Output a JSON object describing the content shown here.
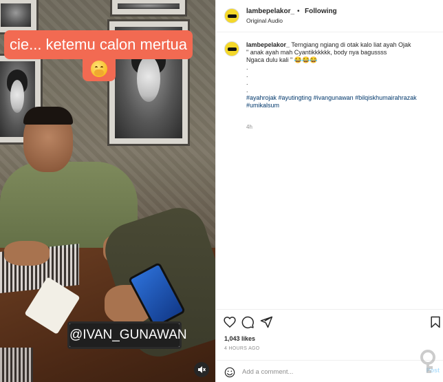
{
  "video": {
    "caption_text": "cie... ketemu calon mertua",
    "emoji": "hand-over-mouth-emoji",
    "tag_text": "@IVAN_GUNAWAN",
    "mute_icon": "speaker-muted-icon"
  },
  "header": {
    "username": "lambepelakor_",
    "dot": "•",
    "following": "Following",
    "audio": "Original Audio"
  },
  "caption": {
    "username": "lambepelakor_",
    "text_line1": "Terngiang ngiang di otak kalo liat ayah Ojak",
    "text_line2": "\" anak ayah mah Cyantikkkkkk, body nya bagussss",
    "text_line3": "Ngaca dulu kali \" 😂😂😂",
    "dots": [
      ".",
      ".",
      ".",
      "."
    ],
    "hashtags_line1": "#ayahrojak #ayutingting #ivangunawan #bilqiskhumairahrazak",
    "hashtags_line2": "#umikalsum",
    "time": "4h"
  },
  "actions": {
    "like_icon": "heart-icon",
    "comment_icon": "comment-icon",
    "share_icon": "send-icon",
    "save_icon": "bookmark-icon"
  },
  "stats": {
    "likes": "1,043 likes",
    "time_ago": "4 HOURS AGO"
  },
  "add_comment": {
    "placeholder": "Add a comment...",
    "post_label": "Post"
  },
  "colors": {
    "caption_bg": "#f26a52",
    "link_blue": "#00376b",
    "post_disabled": "#b2dffc"
  }
}
